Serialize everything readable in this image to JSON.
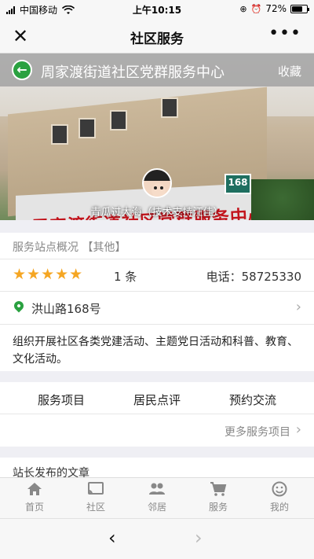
{
  "status": {
    "carrier": "中国移动",
    "time": "上午10:15",
    "battery": "72%"
  },
  "nav": {
    "title": "社区服务"
  },
  "hero": {
    "station_name": "周家渡街道社区党群服务中心",
    "favorite": "收藏",
    "sign_text": "周家渡街道社区党群服务中心",
    "plate": "168",
    "caption": "青瓜过大海（技术支持汪佳）"
  },
  "info": {
    "section_title": "服务站点概况 【其他】",
    "rating_stars": 5,
    "review_count": "1 条",
    "phone": "电话：58725330",
    "address": "洪山路168号",
    "description": "组织开展社区各类党建活动、主题党日活动和科普、教育、文化活动。"
  },
  "tabs": {
    "items": [
      "服务项目",
      "居民点评",
      "预约交流"
    ],
    "more": "更多服务项目"
  },
  "articles": {
    "title": "站长发布的文章"
  },
  "tabbar": {
    "items": [
      {
        "label": "首页",
        "icon": "home-icon"
      },
      {
        "label": "社区",
        "icon": "cast-icon"
      },
      {
        "label": "邻居",
        "icon": "people-icon"
      },
      {
        "label": "服务",
        "icon": "cart-icon"
      },
      {
        "label": "我的",
        "icon": "smile-icon"
      }
    ]
  },
  "colors": {
    "accent": "#2aa140",
    "star": "#f5a623",
    "sign_red": "#c2141c"
  }
}
